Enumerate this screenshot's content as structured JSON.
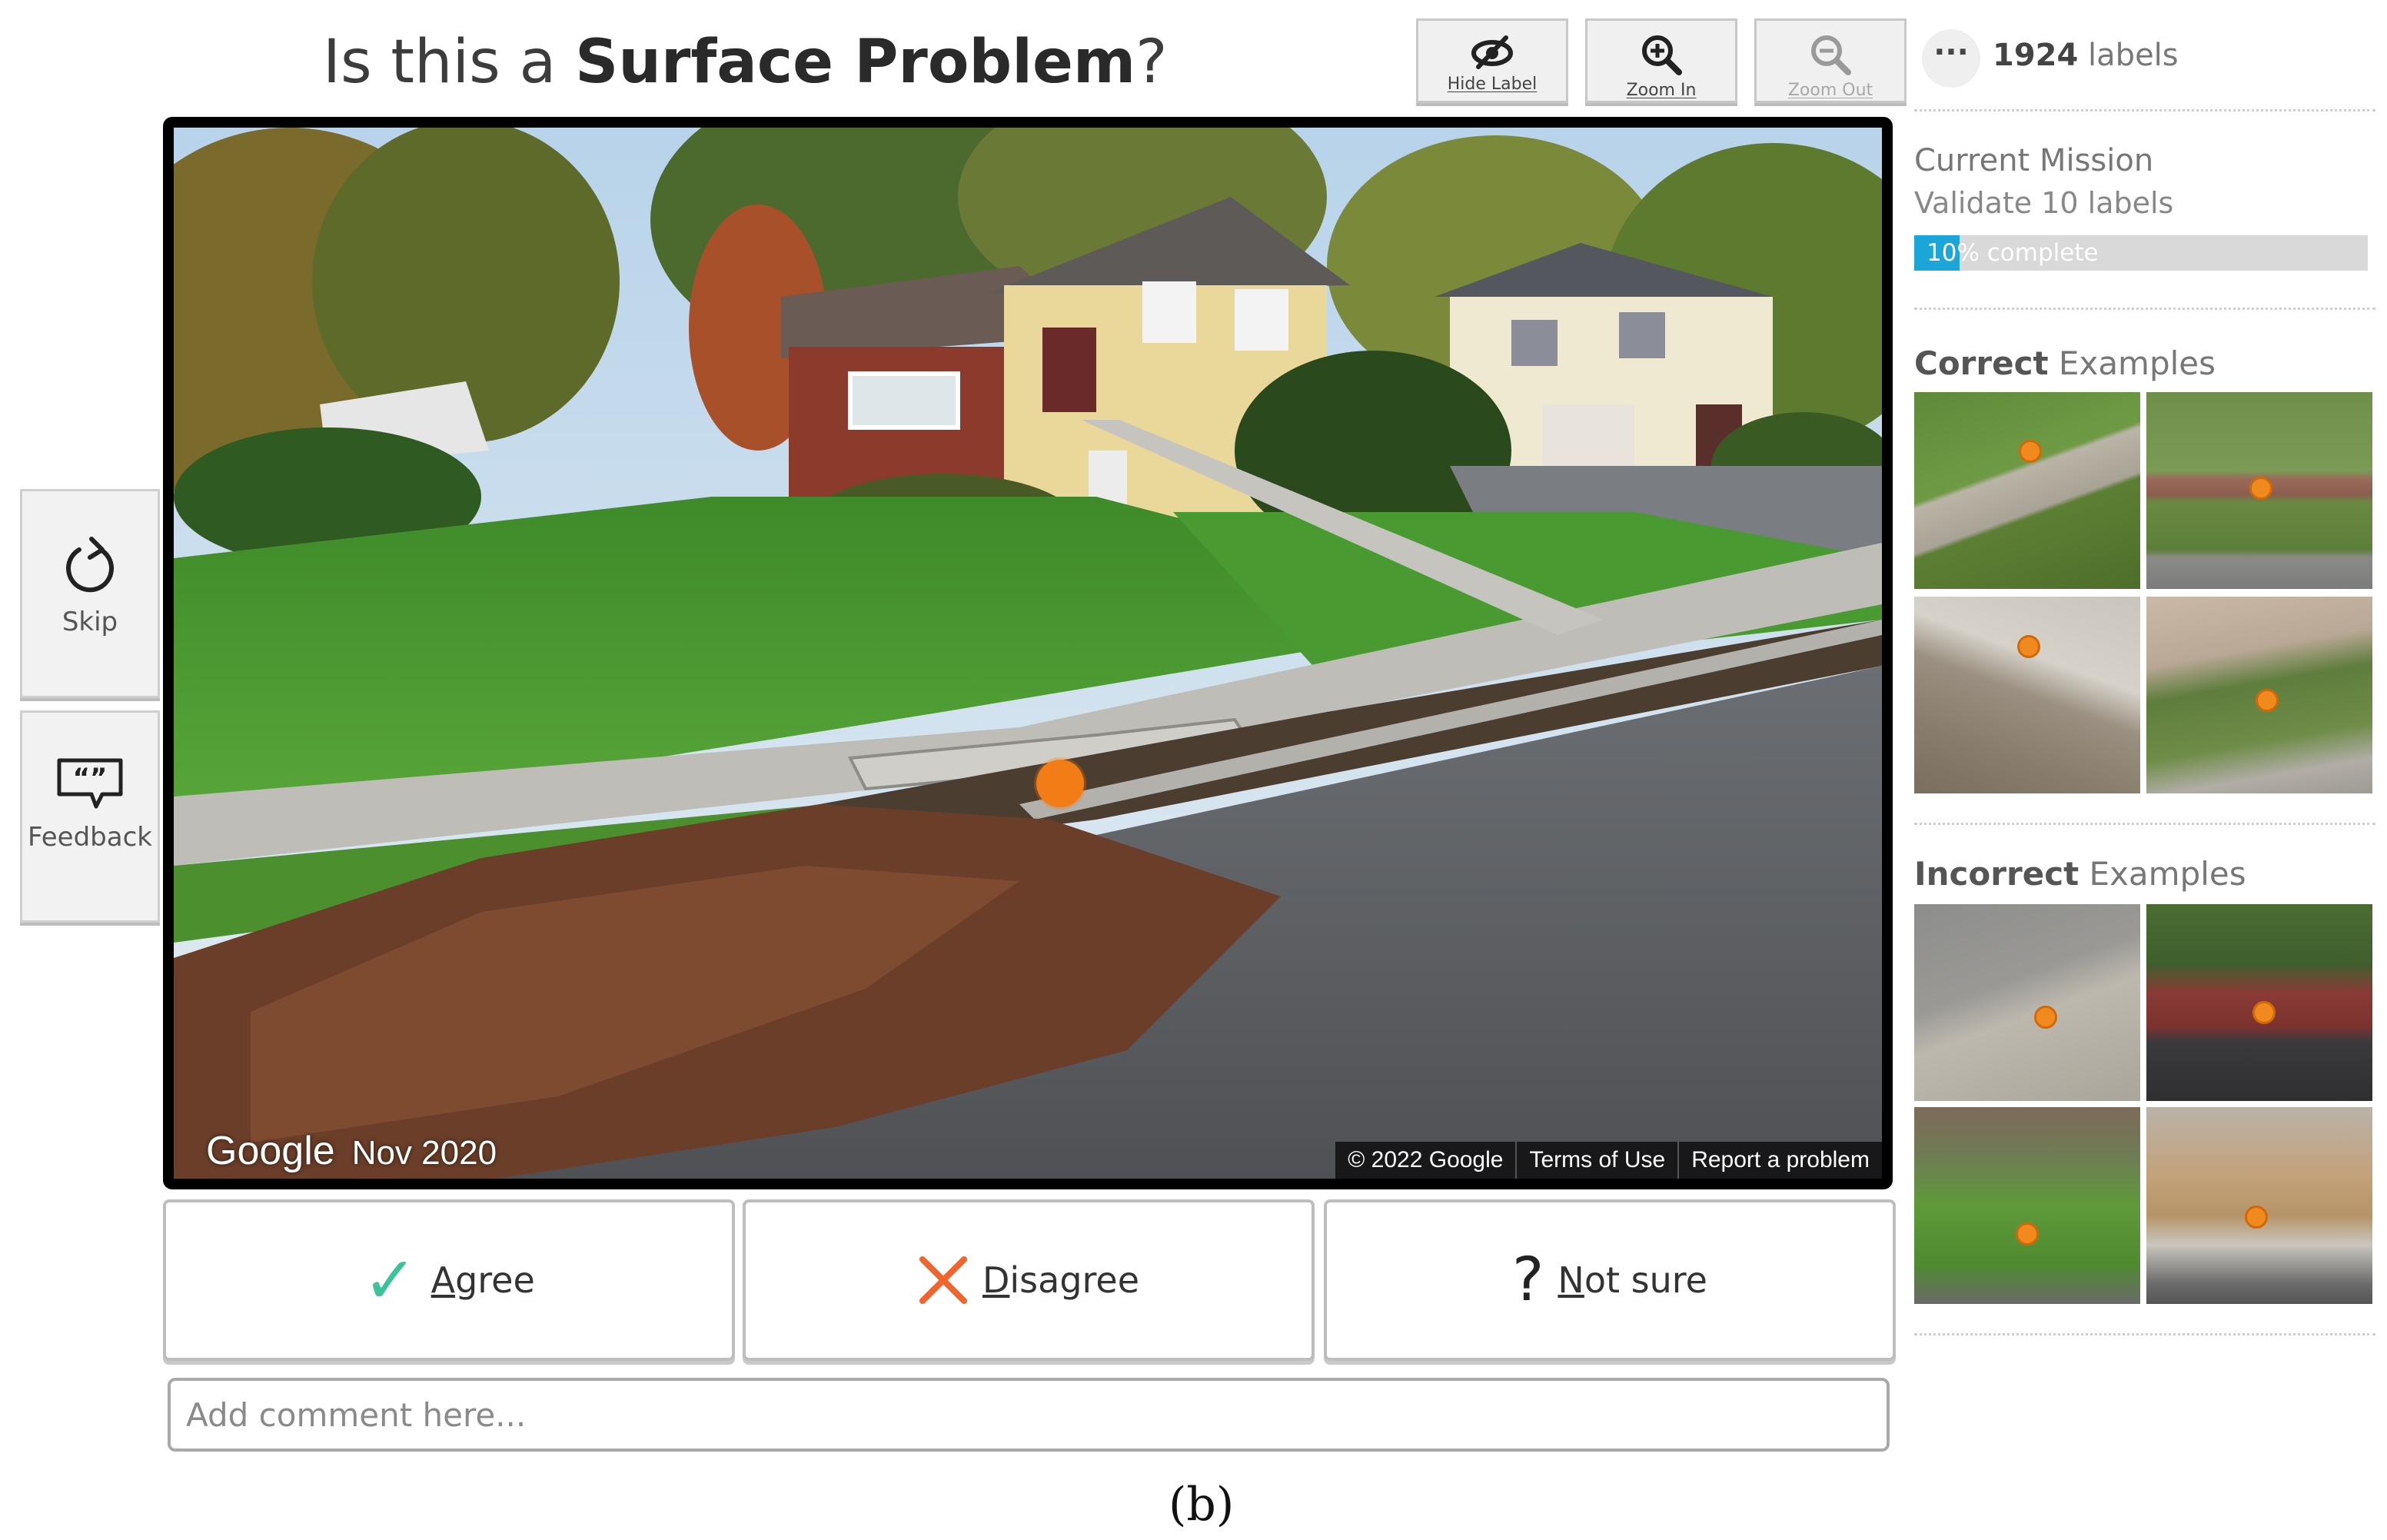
{
  "header": {
    "title_prefix": "Is this a ",
    "title_label_type": "Surface Problem",
    "title_suffix": "?"
  },
  "toolbar": {
    "hide_label": "Hide Label",
    "zoom_in": "Zoom In",
    "zoom_out": "Zoom Out"
  },
  "labels": {
    "more_glyph": "···",
    "count": "1924",
    "unit": "labels"
  },
  "mission": {
    "title": "Current Mission",
    "subtitle": "Validate 10 labels",
    "progress_percent": 10,
    "progress_text": "10% complete"
  },
  "examples": {
    "correct_bold": "Correct",
    "incorrect_bold": "Incorrect",
    "suffix": "Examples"
  },
  "sidebar": {
    "skip": "Skip",
    "feedback": "Feedback"
  },
  "streetview": {
    "brand": "Google",
    "date": "Nov 2020",
    "copyright": "© 2022 Google",
    "terms": "Terms of Use",
    "report": "Report a problem"
  },
  "votes": {
    "agree_icon": "✓",
    "agree_key": "A",
    "agree_rest": "gree",
    "disagree_key": "D",
    "disagree_rest": "isagree",
    "notsure_icon": "?",
    "notsure_key": "N",
    "notsure_rest": "ot sure"
  },
  "comment": {
    "placeholder": "Add comment here..."
  },
  "caption": "(b)",
  "colors": {
    "accent_blue": "#1aa6d8",
    "agree_green": "#3cc39a",
    "disagree_orange": "#f0642e",
    "marker_orange": "#f27d16"
  }
}
